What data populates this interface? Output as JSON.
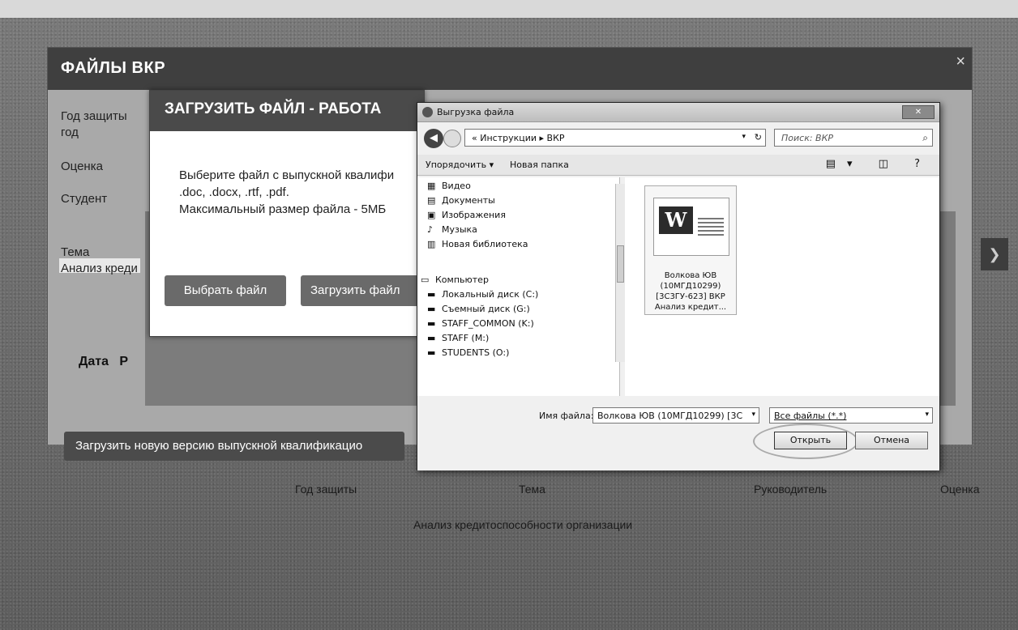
{
  "page": {
    "title": "ФАЙЛЫ ВКР",
    "close_glyph": "×",
    "fields": {
      "year_label": "Год защиты",
      "year_value": "год",
      "grade_label": "Оценка",
      "student_label": "Студент",
      "topic_label": "Тема",
      "topic_value": "Анализ креди"
    },
    "table_header_date": "Дата",
    "table_header_r": "Р",
    "upload_new_button": "Загрузить новую версию выпускной квалификацио",
    "right_icon": "❯"
  },
  "upload_modal": {
    "title": "ЗАГРУЗИТЬ ФАЙЛ - РАБОТА",
    "line1": "Выберите файл с выпускной квалифи",
    "line2": ".doc, .docx, .rtf, .pdf.",
    "line3": "Максимальный размер файла - 5МБ",
    "choose_button": "Выбрать файл",
    "upload_button": "Загрузить файл"
  },
  "background_table": {
    "col_year": "Год защиты",
    "col_topic": "Тема",
    "col_supervisor": "Руководитель",
    "col_grade": "Оценка",
    "row_text": "Анализ кредитоспособности организации"
  },
  "file_dialog": {
    "title": "Выгрузка файла",
    "close_label": "✕",
    "back_glyph": "◀",
    "address": "« Инструкции ▸ ВКР",
    "address_drop": "▾",
    "refresh_glyph": "↻",
    "search_placeholder": "Поиск: ВКР",
    "search_glyph": "⌕",
    "toolbar": {
      "organize": "Упорядочить ▾",
      "new_folder": "Новая папка",
      "view_icons": "▤▾ ◫ ?"
    },
    "nav_items": [
      {
        "icon": "▦",
        "label": "Видео"
      },
      {
        "icon": "▤",
        "label": "Документы"
      },
      {
        "icon": "▣",
        "label": "Изображения"
      },
      {
        "icon": "♪",
        "label": "Музыка"
      },
      {
        "icon": "▥",
        "label": "Новая библиотека"
      },
      {
        "icon": "▭",
        "label": "Компьютер"
      },
      {
        "icon": "▬",
        "label": "Локальный диск (C:)"
      },
      {
        "icon": "▬",
        "label": "Съемный диск (G:)"
      },
      {
        "icon": "▬",
        "label": "STAFF_COMMON (K:)"
      },
      {
        "icon": "▬",
        "label": "STAFF (M:)"
      },
      {
        "icon": "▬",
        "label": "STUDENTS (O:)"
      }
    ],
    "file": {
      "icon_letter": "W",
      "name_line1": "Волкова ЮВ",
      "name_line2": "(10МГД10299)",
      "name_line3": "[3С3ГУ-623] ВКР",
      "name_line4": "Анализ кредит..."
    },
    "filename_label": "Имя файла:",
    "filename_value": "Волкова ЮВ (10МГД10299) [3С",
    "filename_drop": "▾",
    "filter_value": "Все файлы (*.*)",
    "filter_drop": "▾",
    "open_button": "Открыть",
    "cancel_button": "Отмена"
  }
}
